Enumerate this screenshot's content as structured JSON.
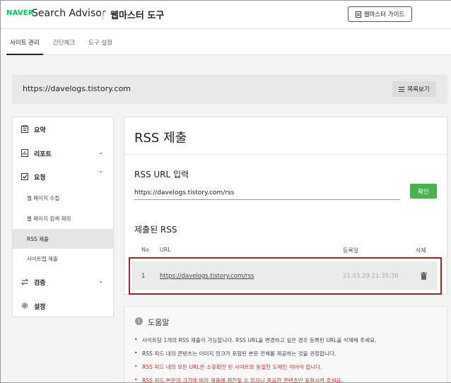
{
  "header": {
    "brand": "NAVER",
    "app_title": "Search Advisor",
    "tool_title": "웹마스터 도구",
    "guide_button": "웹마스터 가이드"
  },
  "tabs": [
    {
      "label": "사이트 관리",
      "active": true
    },
    {
      "label": "간단체크",
      "active": false
    },
    {
      "label": "도구 설정",
      "active": false
    }
  ],
  "site": {
    "url": "https://davelogs.tistory.com",
    "list_button": "목록보기"
  },
  "sidebar": {
    "items": [
      {
        "label": "요약",
        "icon": "clipboard-icon"
      },
      {
        "label": "리포트",
        "icon": "bar-chart-icon",
        "chevron": "down"
      },
      {
        "label": "요청",
        "icon": "checkbox-icon",
        "chevron": "up"
      },
      {
        "label": "검증",
        "icon": "swap-arrows-icon",
        "chevron": "down"
      },
      {
        "label": "설정",
        "icon": "gear-icon"
      }
    ],
    "sub_items": [
      {
        "label": "웹 페이지 수집"
      },
      {
        "label": "웹 페이지 검색 제외"
      },
      {
        "label": "RSS 제출",
        "active": true
      },
      {
        "label": "사이트맵 제출"
      }
    ]
  },
  "main": {
    "title": "RSS 제출",
    "input_label": "RSS URL 입력",
    "input_value": "https://davelogs.tistory.com/rss",
    "confirm_button": "확인",
    "submitted_label": "제출된 RSS",
    "table": {
      "headers": [
        "No",
        "URL",
        "등록일",
        "삭제"
      ],
      "rows": [
        {
          "no": "1",
          "url": "https://davelogs.tistory.com/rss",
          "date": "21.03.29 21:35:36"
        }
      ]
    }
  },
  "help": {
    "title": "도움말",
    "lines": [
      {
        "text": "사이트당 1개의 RSS 제출이 가능합니다. RSS URL을 변경하고 싶은 경우 등록된 URL을 삭제해 주세요.",
        "emphasis": false
      },
      {
        "text": "RSS 피드 내의 콘텐츠는 이미지 링크가 포함된 본문 전체를 제공하는 것을 권장합니다.",
        "emphasis": false
      },
      {
        "text": "RSS 피드 내의 모든 URL은 소유확인 된 사이트와 동일한 도메인 이어야 합니다.",
        "emphasis": true
      },
      {
        "text": "RSS 피드 본문의 크기에 따라 제출에 제한될 수 있으니 중요한 콘텐츠만 포함시켜 주세요.",
        "emphasis": true
      }
    ]
  },
  "colors": {
    "naver_green": "#03c75a",
    "confirm_green": "#4caf50",
    "highlight_red": "#9b2b2b",
    "warning_red": "#c0392b"
  }
}
